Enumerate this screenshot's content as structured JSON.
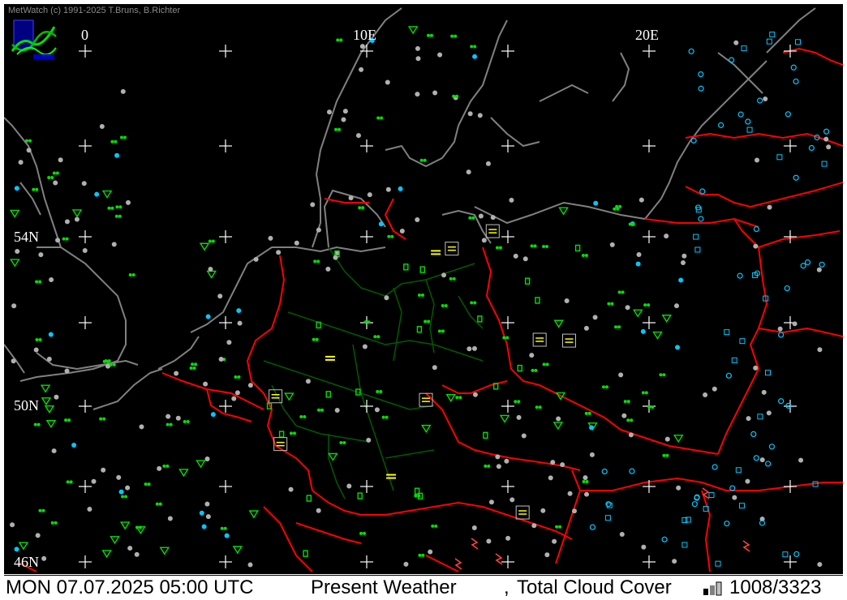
{
  "copyright": "MetWatch  (c) 1991-2025 T.Bruns, B.Richter",
  "lon_labels": [
    "0",
    "10E",
    "20E"
  ],
  "lat_labels": [
    "54N",
    "50N",
    "46N"
  ],
  "status": {
    "datetime": "MON 07.07.2025 05:00 UTC",
    "parameter": "Present Weather",
    "separator": ",",
    "parameter2": "Total Cloud Cover",
    "count": "1008/3323"
  },
  "colors": {
    "background": "#000000",
    "coastline": "#808080",
    "borders": "#ff0000",
    "german_states": "#005a00",
    "rain_symbol": "#00e000",
    "fog_symbol": "#ffff00",
    "station_dot": "#b0b0b0",
    "station_clear": "#00c8ff",
    "thunder_symbol": "#ff4040"
  }
}
